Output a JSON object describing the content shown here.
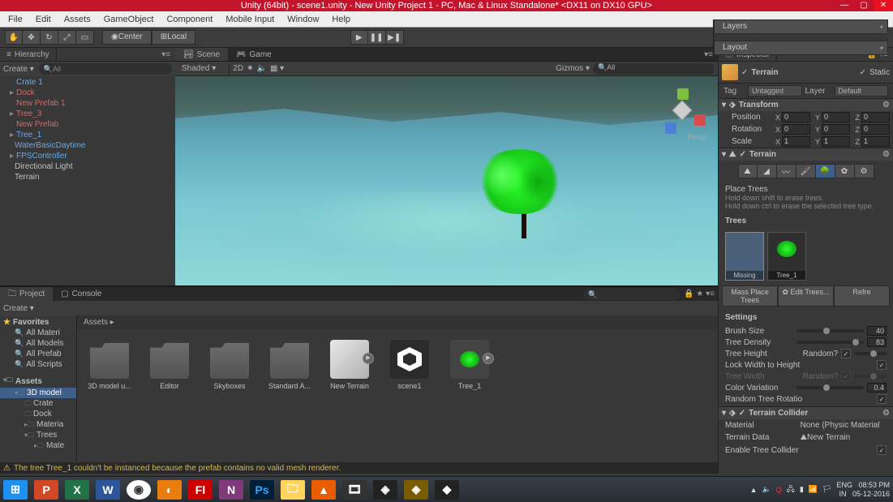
{
  "title": "Unity (64bit) - scene1.unity - New Unity Project 1 - PC, Mac & Linux Standalone* <DX11 on DX10 GPU>",
  "menu": [
    "File",
    "Edit",
    "Assets",
    "GameObject",
    "Component",
    "Mobile Input",
    "Window",
    "Help"
  ],
  "toolbar": {
    "pivot_center": "Center",
    "pivot_local": "Local",
    "layers": "Layers",
    "layout": "Layout"
  },
  "hierarchy": {
    "title": "Hierarchy",
    "create": "Create",
    "search_placeholder": "All",
    "items": [
      {
        "name": "Crate 1",
        "cls": "blue"
      },
      {
        "name": "Dock",
        "cls": "red",
        "arrow": "▸"
      },
      {
        "name": "New Prefab 1",
        "cls": "red"
      },
      {
        "name": "Tree_3",
        "cls": "red",
        "arrow": "▸"
      },
      {
        "name": "New Prefab",
        "cls": "red"
      },
      {
        "name": "Tree_1",
        "cls": "blue",
        "arrow": "▸"
      },
      {
        "name": "WaterBasicDaytime",
        "cls": "blue",
        "indent": true
      },
      {
        "name": "FPSController",
        "cls": "blue",
        "arrow": "▸"
      },
      {
        "name": "Directional Light",
        "cls": "",
        "indent": true
      },
      {
        "name": "Terrain",
        "cls": "",
        "indent": true
      }
    ]
  },
  "scene": {
    "tab_scene": "Scene",
    "tab_game": "Game",
    "shaded": "Shaded",
    "twod": "2D",
    "gizmos": "Gizmos",
    "search_placeholder": "All",
    "persp": "Persp"
  },
  "project": {
    "tab_project": "Project",
    "tab_console": "Console",
    "create": "Create",
    "favorites": "Favorites",
    "fav_items": [
      "All Materi",
      "All Models",
      "All Prefab",
      "All Scripts"
    ],
    "assets_hdr": "Assets",
    "folders": [
      {
        "name": "3D model",
        "arrow": "▾",
        "sel": true
      },
      {
        "name": "Crate",
        "indent": 1
      },
      {
        "name": "Dock",
        "indent": 1
      },
      {
        "name": "Materia",
        "indent": 1,
        "arrow": "▸"
      },
      {
        "name": "Trees",
        "indent": 1,
        "arrow": "▾"
      },
      {
        "name": "Mate",
        "indent": 2,
        "arrow": "▸"
      }
    ],
    "breadcrumb": "Assets ▸",
    "grid": [
      {
        "label": "3D model u...",
        "type": "folder"
      },
      {
        "label": "Editor",
        "type": "folder"
      },
      {
        "label": "Skyboxes",
        "type": "folder"
      },
      {
        "label": "Standard A...",
        "type": "folder"
      },
      {
        "label": "New Terrain",
        "type": "prefab",
        "play": true
      },
      {
        "label": "scene1",
        "type": "scene"
      },
      {
        "label": "Tree_1",
        "type": "tree",
        "play": true
      }
    ]
  },
  "inspector": {
    "title": "Inspector",
    "obj_name": "Terrain",
    "static": "Static",
    "tag_lbl": "Tag",
    "tag_val": "Untagged",
    "layer_lbl": "Layer",
    "layer_val": "Default",
    "transform": {
      "title": "Transform",
      "position": {
        "x": "0",
        "y": "0",
        "z": "0"
      },
      "rotation": {
        "x": "0",
        "y": "0",
        "z": "0"
      },
      "scale": {
        "x": "1",
        "y": "1",
        "z": "1"
      },
      "lbl_pos": "Position",
      "lbl_rot": "Rotation",
      "lbl_scale": "Scale"
    },
    "terrain": {
      "title": "Terrain",
      "place_title": "Place Trees",
      "hint1": "Hold down shift to erase trees.",
      "hint2": "Hold down ctrl to erase the selected tree type.",
      "trees_hdr": "Trees",
      "slot_missing": "Missing",
      "slot_tree": "Tree_1",
      "btn_mass": "Mass Place Trees",
      "btn_edit": "✿ Edit Trees...",
      "btn_refresh": "Refre",
      "settings": "Settings",
      "brush_size": "Brush Size",
      "brush_val": "40",
      "density": "Tree Density",
      "density_val": "83",
      "height": "Tree Height",
      "random": "Random?",
      "lock": "Lock Width to Height",
      "width": "Tree Width",
      "color_var": "Color Variation",
      "color_val": "0.4",
      "rand_rot": "Random Tree Rotatio"
    },
    "collider": {
      "title": "Terrain Collider",
      "material": "Material",
      "mat_val": "None (Physic Material",
      "data": "Terrain Data",
      "data_val": "New Terrain",
      "enable": "Enable Tree Collider"
    }
  },
  "status": "The tree Tree_1 couldn't be instanced because the prefab contains no valid mesh renderer.",
  "taskbar": {
    "lang": "ENG",
    "region": "IN",
    "time": "08:53 PM",
    "date": "05-12-2016"
  }
}
